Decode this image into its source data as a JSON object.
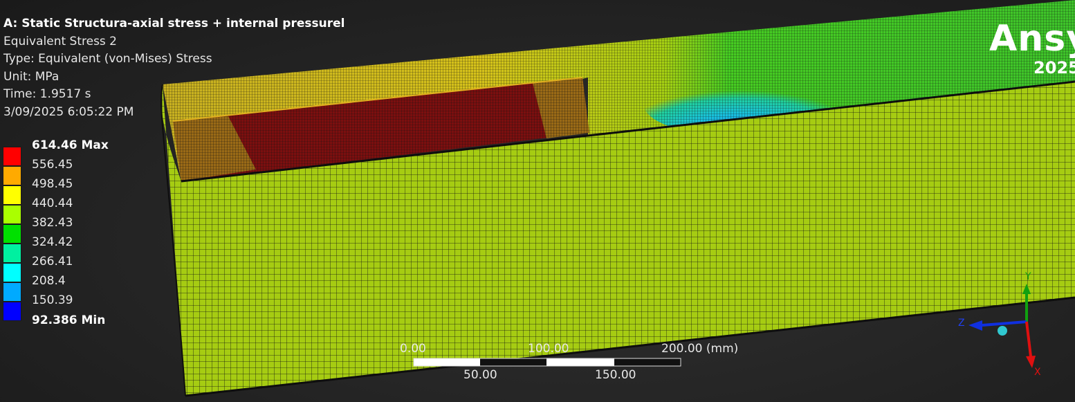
{
  "header": {
    "title": "A: Static Structura-axial stress + internal pressurel",
    "result_name": "Equivalent Stress 2",
    "type": "Type: Equivalent (von-Mises) Stress",
    "unit": "Unit: MPa",
    "time": "Time: 1.9517 s",
    "timestamp": "3/09/2025 6:05:22 PM"
  },
  "legend": {
    "max_label": "614.46 Max",
    "min_label": "92.386 Min",
    "levels": [
      "556.45",
      "498.45",
      "440.44",
      "382.43",
      "324.42",
      "266.41",
      "208.4",
      "150.39"
    ],
    "colors": [
      "#ff0000",
      "#ffaa00",
      "#ffff00",
      "#aaff00",
      "#00e000",
      "#00f0a0",
      "#00ffff",
      "#00aaff",
      "#0000ff"
    ]
  },
  "brand": {
    "logo": "Ansy",
    "year": "2025"
  },
  "scale_bar": {
    "top_labels": [
      "0.00",
      "100.00",
      "200.00 (mm)"
    ],
    "bottom_labels": [
      "50.00",
      "150.00"
    ]
  },
  "triad": {
    "y": "Y",
    "z": "Z",
    "x": "X",
    "colors": {
      "x": "#e01010",
      "y": "#10a010",
      "z": "#1030e0"
    }
  },
  "model_colors": {
    "surface": "#a6cc12",
    "inner": "#b4d610",
    "crack": "#7a0e0e",
    "blue_zone": "#1fb6e8",
    "green_zone": "#2fc23a"
  }
}
